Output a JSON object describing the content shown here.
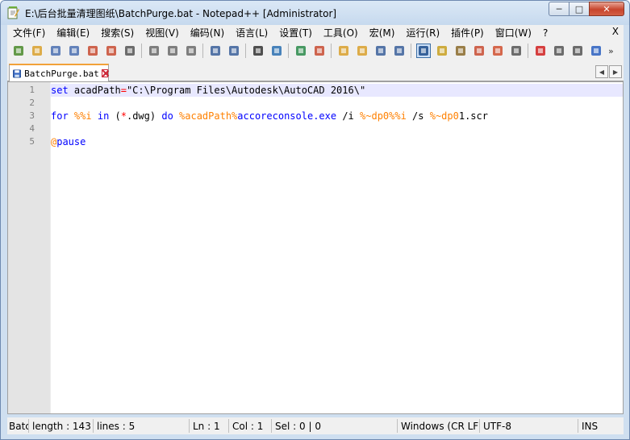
{
  "window": {
    "title": "E:\\后台批量清理图纸\\BatchPurge.bat - Notepad++ [Administrator]",
    "buttons": {
      "minimize": "─",
      "maximize": "□",
      "close": "✕"
    }
  },
  "menu": {
    "items": [
      "文件(F)",
      "编辑(E)",
      "搜索(S)",
      "视图(V)",
      "编码(N)",
      "语言(L)",
      "设置(T)",
      "工具(O)",
      "宏(M)",
      "运行(R)",
      "插件(P)",
      "窗口(W)",
      "?"
    ],
    "close": "X"
  },
  "toolbar": {
    "icons": [
      "new-file-icon",
      "open-file-icon",
      "save-icon",
      "save-all-icon",
      "close-icon",
      "close-all-icon",
      "print-icon",
      "cut-icon",
      "copy-icon",
      "paste-icon",
      "undo-icon",
      "redo-icon",
      "find-icon",
      "replace-icon",
      "zoom-in-icon",
      "zoom-out-icon",
      "sync-vertical-icon",
      "sync-horizontal-icon",
      "word-wrap-icon",
      "show-all-chars-icon",
      "indent-guide-icon",
      "user-defined-lang-icon",
      "doc-map-icon",
      "function-list-icon",
      "folder-workspace-icon",
      "monitoring-icon",
      "record-macro-icon",
      "stop-macro-icon",
      "play-macro-icon",
      "run-macro-multiple-icon"
    ],
    "active_icon": "indent-guide-icon",
    "more": "»"
  },
  "tabs": [
    {
      "label": "BatchPurge.bat",
      "active": true
    }
  ],
  "tab_nav": {
    "prev": "◀",
    "next": "▶"
  },
  "editor": {
    "current_line": 1,
    "lines": [
      {
        "num": "1",
        "tokens": [
          {
            "t": "set",
            "c": "kw"
          },
          {
            "t": " acadPath",
            "c": "def"
          },
          {
            "t": "=",
            "c": "op"
          },
          {
            "t": "\"C:\\Program Files\\Autodesk\\AutoCAD 2016\\\"",
            "c": "def"
          }
        ]
      },
      {
        "num": "2",
        "tokens": []
      },
      {
        "num": "3",
        "tokens": [
          {
            "t": "for",
            "c": "kw"
          },
          {
            "t": " ",
            "c": "def"
          },
          {
            "t": "%%i",
            "c": "var"
          },
          {
            "t": " ",
            "c": "def"
          },
          {
            "t": "in",
            "c": "kw"
          },
          {
            "t": " (",
            "c": "def"
          },
          {
            "t": "*",
            "c": "op"
          },
          {
            "t": ".dwg) ",
            "c": "def"
          },
          {
            "t": "do",
            "c": "kw"
          },
          {
            "t": " ",
            "c": "def"
          },
          {
            "t": "%acadPath%",
            "c": "var"
          },
          {
            "t": "accoreconsole.exe",
            "c": "kw"
          },
          {
            "t": " /i ",
            "c": "def"
          },
          {
            "t": "%~dp0%%i",
            "c": "var"
          },
          {
            "t": " /s ",
            "c": "def"
          },
          {
            "t": "%~dp0",
            "c": "var"
          },
          {
            "t": "1.scr",
            "c": "def"
          }
        ]
      },
      {
        "num": "4",
        "tokens": []
      },
      {
        "num": "5",
        "tokens": [
          {
            "t": "@",
            "c": "var"
          },
          {
            "t": "pause",
            "c": "kw"
          }
        ]
      }
    ]
  },
  "status": {
    "file_type": "Batc",
    "length": "length : 143",
    "lines": "lines : 5",
    "ln": "Ln : 1",
    "col": "Col : 1",
    "sel": "Sel : 0 | 0",
    "eol": "Windows (CR LF)",
    "encoding": "UTF-8",
    "mode": "INS"
  },
  "colors": {
    "keyword": "#0000ff",
    "variable": "#ff8000",
    "operator": "#ff0000",
    "current_line": "#e8e8ff",
    "tab_accent": "#f2a23a"
  }
}
